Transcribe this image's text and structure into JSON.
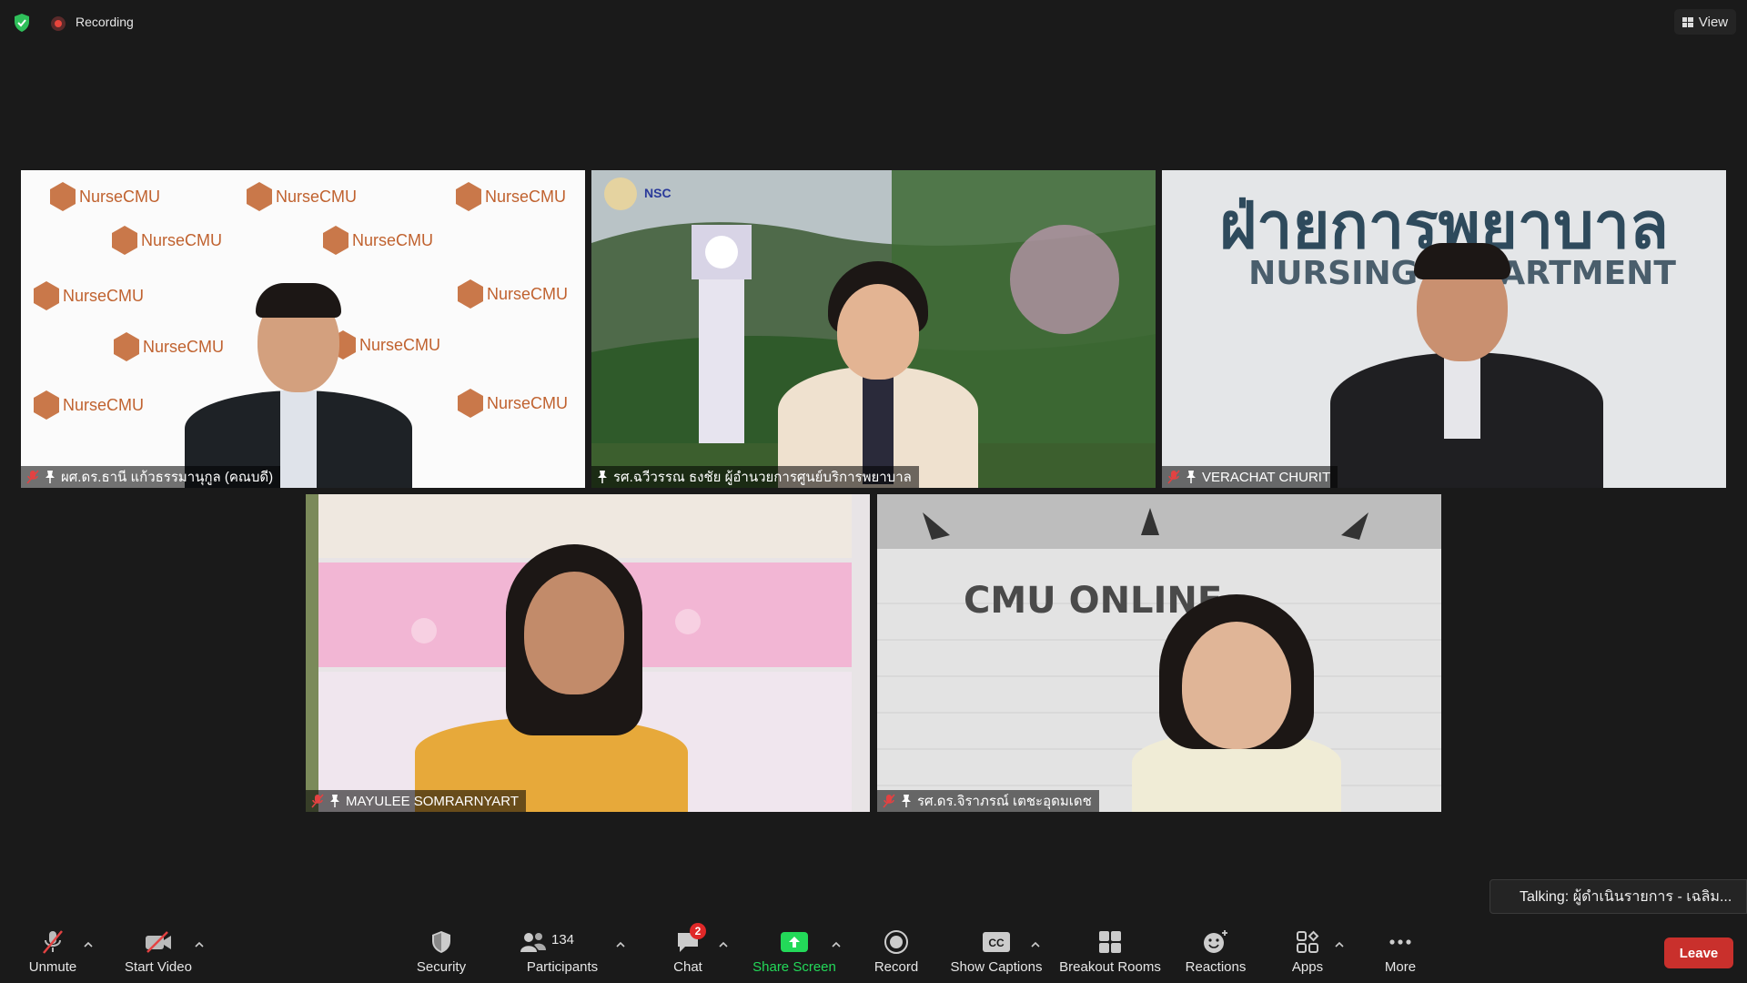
{
  "top_bar": {
    "recording_label": "Recording",
    "view_label": "View"
  },
  "video_tiles": [
    {
      "name": "ผศ.ดร.ธานี แก้วธรรมานุกูล (คณบดี)",
      "muted": true,
      "pinned": true,
      "background_text": "NurseCMU"
    },
    {
      "name": "รศ.ฉวีวรรณ ธงชัย ผู้อำนวยการศูนย์บริการพยาบาล",
      "muted": false,
      "pinned": true,
      "background_text": "NSC"
    },
    {
      "name": "VERACHAT CHURIT",
      "muted": true,
      "pinned": true,
      "background_text_thai": "ฝ่ายการพยาบาล",
      "background_text_en": "NURSING DEPARTMENT"
    },
    {
      "name": "MAYULEE SOMRARNYART",
      "muted": true,
      "pinned": true
    },
    {
      "name": "รศ.ดร.จิราภรณ์ เตชะอุดมเดช",
      "muted": true,
      "pinned": true,
      "background_text": "CMU ONLINE"
    }
  ],
  "talking_indicator": "Talking: ผู้ดำเนินรายการ - เฉลิม...",
  "toolbar": {
    "unmute": "Unmute",
    "start_video": "Start Video",
    "security": "Security",
    "participants": "Participants",
    "participants_count": "134",
    "chat": "Chat",
    "chat_badge": "2",
    "share_screen": "Share Screen",
    "record": "Record",
    "show_captions": "Show Captions",
    "breakout_rooms": "Breakout Rooms",
    "reactions": "Reactions",
    "apps": "Apps",
    "more": "More",
    "leave": "Leave"
  },
  "colors": {
    "background": "#1a1a1a",
    "share_green": "#23d959",
    "leave_red": "#c9302c",
    "shield_green": "#2fbf5a",
    "badge_red": "#e02828"
  }
}
